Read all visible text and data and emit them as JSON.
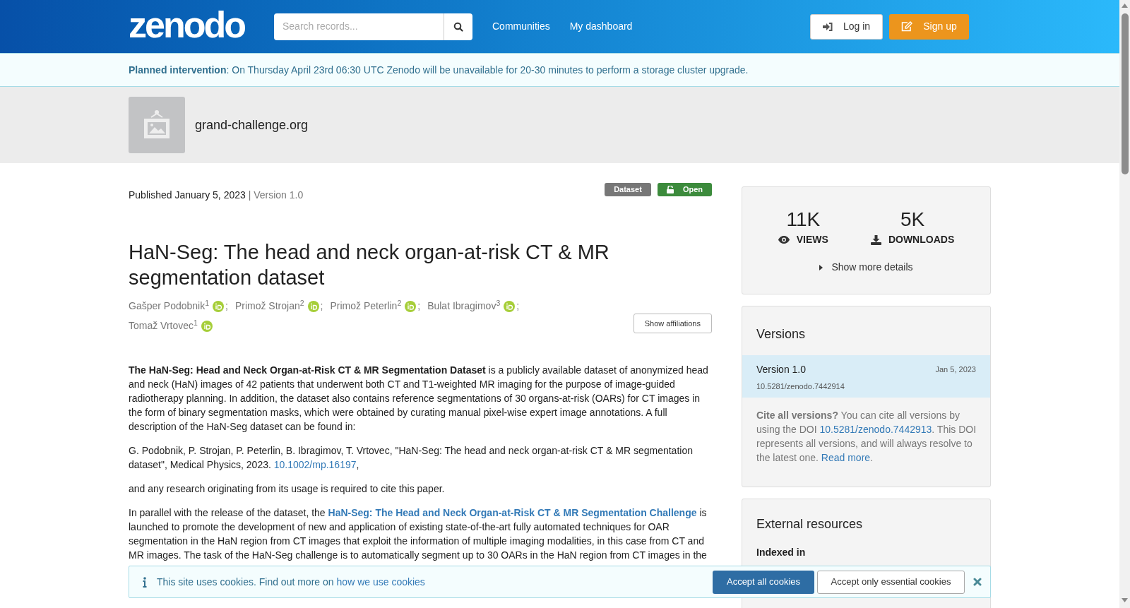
{
  "navbar": {
    "logo": "zenodo",
    "search": {
      "placeholder": "Search records..."
    },
    "links": [
      "Communities",
      "My dashboard"
    ],
    "buttons": [
      {
        "kind": "login",
        "label": "Log in"
      },
      {
        "kind": "signup",
        "label": "Sign up"
      }
    ]
  },
  "announcement": "**Planned intervention**: On Thursday April 23rd 06:30 UTC Zenodo will be unavailable for 20-30 minutes to perform a storage cluster upgrade.",
  "community": {
    "name": "grand-challenge.org"
  },
  "record": {
    "published": "Published January 5, 2023",
    "version": "| Version 1.0",
    "badges": [
      {
        "kind": "type",
        "label": "Dataset"
      },
      {
        "kind": "access",
        "label": "Open"
      }
    ],
    "title": "HaN-Seg: The head and neck organ-at-risk CT & MR segmentation dataset",
    "creators": [
      {
        "name": "Gašper Podobnik$^{1}$",
        "orcid": true,
        "separator": ";"
      },
      {
        "name": "Primož Strojan$^{2}$",
        "orcid": true,
        "separator": ";"
      },
      {
        "name": "Primož Peterlin$^{2}$",
        "orcid": true,
        "separator": ";"
      },
      {
        "name": "Bulat Ibragimov$^{3}$",
        "orcid": true,
        "separator": ";"
      },
      {
        "name": "Tomaž Vrtovec$^{1}$",
        "orcid": true
      }
    ],
    "show_affiliations": "Show affiliations",
    "description": [
      [
        {
          "kind": "text",
          "text": "**The HaN-Seg: Head and Neck Organ-at-Risk CT & MR Segmentation Dataset** is a publicly available dataset of anonymized head and neck (HaN) images of 42 patients that underwent both CT and T1-weighted MR imaging for the purpose of image-guided radiotherapy planning. In addition, the dataset also contains reference segmentations of 30 organs-at-risk (OARs) for CT images in the form of binary segmentation masks, which were obtained by curating manual pixel-wise expert image annotations. A full description of the HaN-Seg dataset can be found in:"
        }
      ],
      [
        {
          "kind": "text",
          "text": "G. Podobnik, P. Strojan, P. Peterlin, B. Ibragimov, T. Vrtovec, \"HaN-Seg: The head and neck organ-at-risk CT & MR segmentation dataset\", Medical Physics, 2023. "
        },
        {
          "kind": "link",
          "text": "10.1002/mp.16197"
        },
        {
          "kind": "text",
          "text": ","
        }
      ],
      [
        {
          "kind": "text",
          "text": "and any research originating from its usage is required to cite this paper."
        }
      ],
      [
        {
          "kind": "text",
          "text": "In parallel with the release of the dataset, the "
        },
        {
          "kind": "boldlink",
          "text": "HaN-Seg: The Head and Neck Organ-at-Risk CT & MR Segmentation Challenge"
        },
        {
          "kind": "text",
          "text": " is launched to promote the development of new and application of existing state-of-the-art fully automated techniques for OAR segmentation in the HaN region from CT images that exploit the information of multiple imaging modalities, in this case from CT and MR images. The task of the HaN-Seg challenge is to automatically segment up to 30 OARs in the HaN region from CT images in the"
        }
      ]
    ]
  },
  "stats": {
    "items": [
      {
        "kind": "views",
        "value": "11K",
        "label": "VIEWS"
      },
      {
        "kind": "downloads",
        "value": "5K",
        "label": "DOWNLOADS"
      }
    ],
    "show_more": "Show more details",
    "expanded": false
  },
  "versions": {
    "title": "Versions",
    "items": [
      {
        "label": "Version 1.0",
        "date": "Jan 5, 2023",
        "doi": "10.5281/zenodo.7442914",
        "selected": true
      }
    ],
    "cite": [
      {
        "kind": "text",
        "text": "**Cite all versions?** You can cite all versions by using the DOI "
      },
      {
        "kind": "link",
        "text": "10.5281/zenodo.7442913"
      },
      {
        "kind": "text",
        "text": ". This DOI represents all versions, and will always resolve to the latest one. "
      },
      {
        "kind": "link",
        "text": "Read more"
      },
      {
        "kind": "text",
        "text": "."
      }
    ]
  },
  "external": {
    "title": "External resources",
    "indexed_in": "Indexed in"
  },
  "cookie_banner": {
    "text": "This site uses cookies. Find out more on ",
    "link": "how we use cookies",
    "buttons": [
      {
        "kind": "primary",
        "label": "Accept all cookies"
      },
      {
        "kind": "secondary",
        "label": "Accept only essential cookies"
      }
    ]
  }
}
